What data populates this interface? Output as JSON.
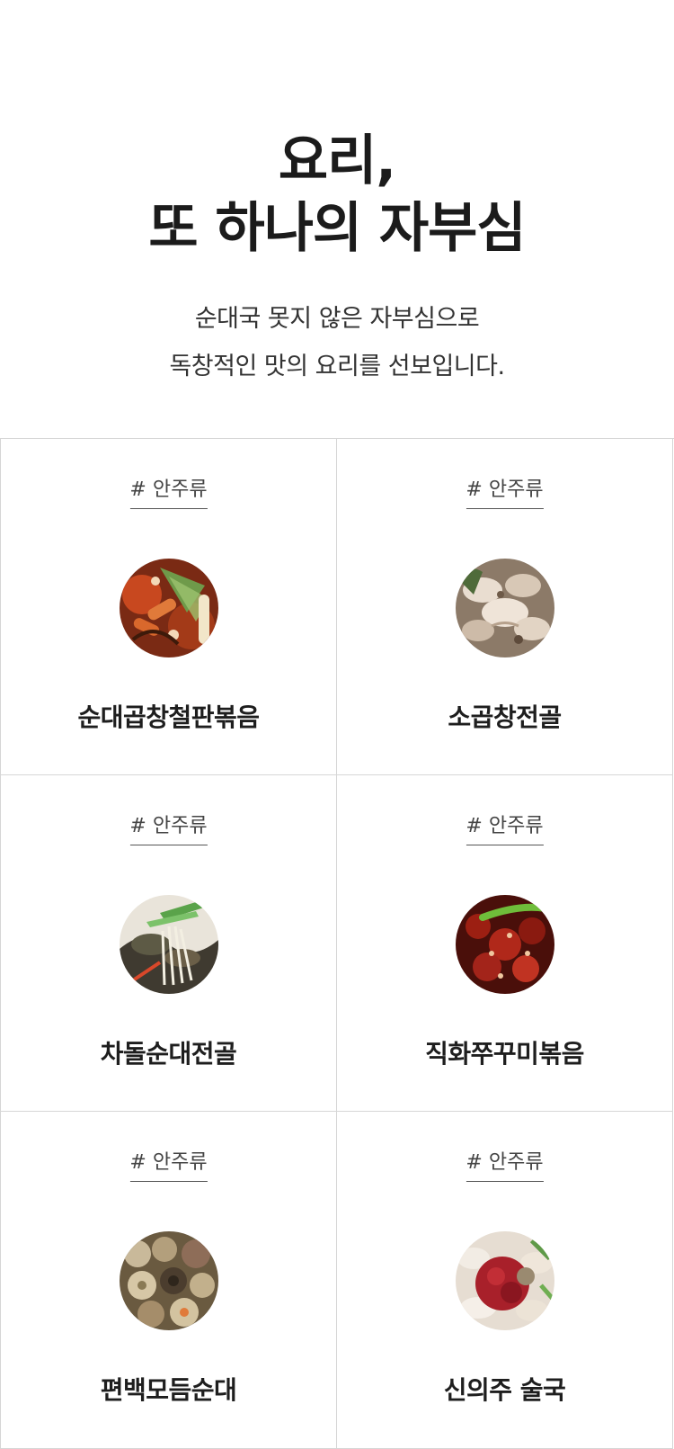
{
  "hero": {
    "title_line1": "요리,",
    "title_line2": "또 하나의 자부심",
    "desc_line1": "순대국 못지 않은 자부심으로",
    "desc_line2": "독창적인 맛의 요리를 선보입니다."
  },
  "menu": [
    {
      "tag": "# 안주류",
      "name": "순대곱창철판볶음",
      "image_icon": "stir-fried-tripe-photo"
    },
    {
      "tag": "# 안주류",
      "name": "소곱창전골",
      "image_icon": "beef-tripe-hotpot-photo"
    },
    {
      "tag": "# 안주류",
      "name": "차돌순대전골",
      "image_icon": "brisket-sundae-hotpot-photo"
    },
    {
      "tag": "# 안주류",
      "name": "직화쭈꾸미볶음",
      "image_icon": "grilled-webfoot-octopus-photo"
    },
    {
      "tag": "# 안주류",
      "name": "편백모듬순대",
      "image_icon": "steamed-assorted-sundae-photo"
    },
    {
      "tag": "# 안주류",
      "name": "신의주 술국",
      "image_icon": "sinuiju-soup-photo"
    }
  ],
  "colors": {
    "text": "#222222",
    "border": "#d6d6d6",
    "background": "#ffffff"
  }
}
